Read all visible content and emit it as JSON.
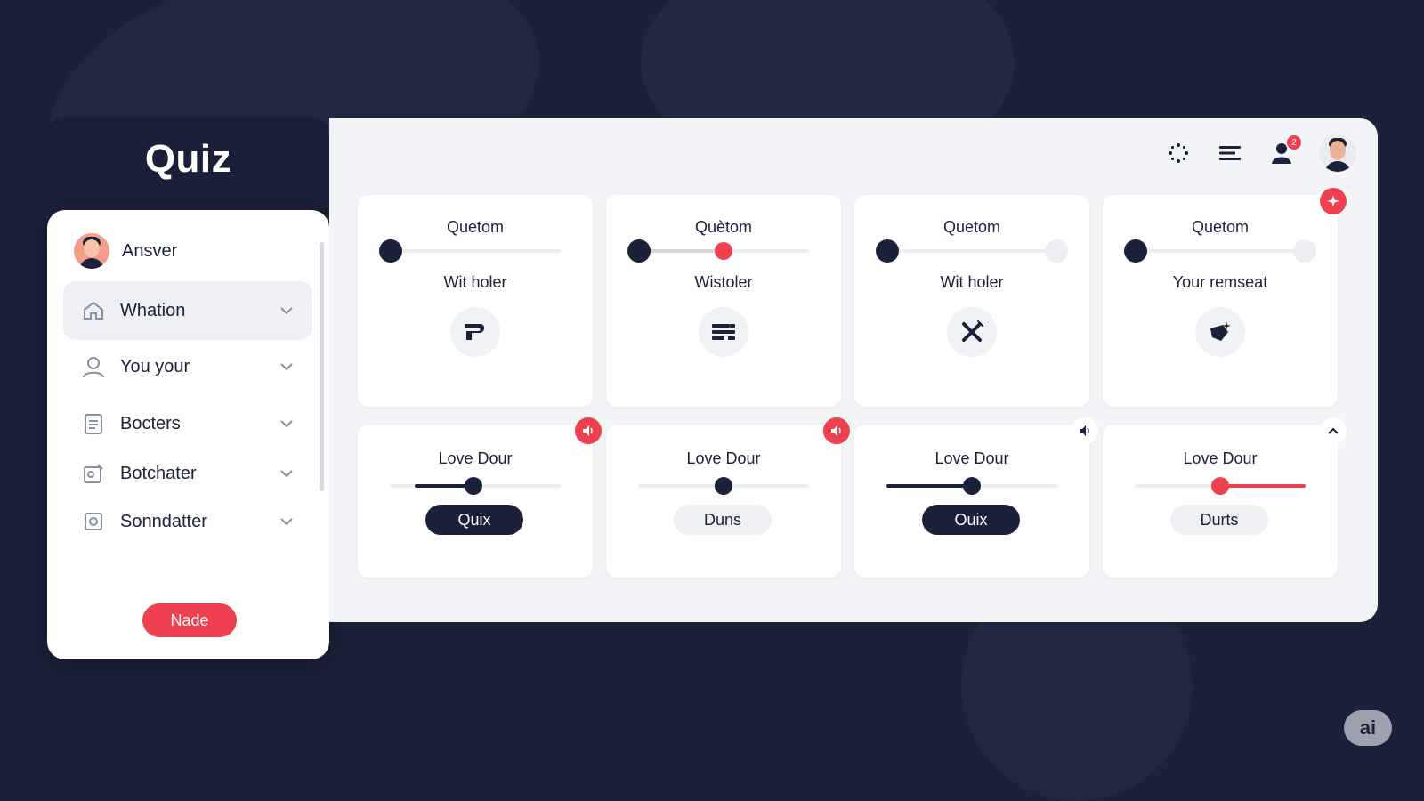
{
  "app": {
    "title": "Quiz"
  },
  "sidebar": {
    "user": {
      "name": "Ansver",
      "avatar": "avatar"
    },
    "items": [
      {
        "label": "Whation",
        "icon": "home-icon",
        "active": true
      },
      {
        "label": "You your",
        "icon": "user-icon",
        "active": false
      },
      {
        "label": "Bocters",
        "icon": "document-icon",
        "active": false
      },
      {
        "label": "Botchater",
        "icon": "edit-image-icon",
        "active": false
      },
      {
        "label": "Sonndatter",
        "icon": "frame-icon",
        "active": false
      }
    ],
    "action_label": "Nade"
  },
  "topbar": {
    "icons": [
      "loading-spinner-icon",
      "menu-lines-icon",
      "profile-icon",
      "user-avatar"
    ],
    "notification_count": "2"
  },
  "question_cards": [
    {
      "title": "Quetom",
      "subtitle": "Wit holer",
      "slider_value": 0.0,
      "icon": "flag-icon"
    },
    {
      "title": "Quètom",
      "subtitle": "Wistoler",
      "slider_value": 0.5,
      "icon": "list-icon"
    },
    {
      "title": "Quetom",
      "subtitle": "Wit holer",
      "slider_value": 0.0,
      "icon": "close-tools-icon"
    },
    {
      "title": "Quetom",
      "subtitle": "Your remseat",
      "slider_value": 0.0,
      "icon": "magic-shape-icon",
      "badge": "sparkle-icon"
    }
  ],
  "audio_cards": [
    {
      "title": "Love Dour",
      "slider_value": 0.35,
      "button": "Quix",
      "button_style": "dark",
      "badge": "speaker-icon"
    },
    {
      "title": "Love Dour",
      "slider_value": 0.5,
      "button": "Duns",
      "button_style": "light",
      "badge": "speaker-icon"
    },
    {
      "title": "Love Dour",
      "slider_value": 0.5,
      "button": "Ouix",
      "button_style": "dark",
      "badge": "volume-icon"
    },
    {
      "title": "Love Dour",
      "slider_value": 0.5,
      "button": "Durts",
      "button_style": "light",
      "badge": "chevron-up-icon"
    }
  ],
  "watermark": "ai",
  "colors": {
    "navy": "#1b2139",
    "accent": "#ef4050",
    "panel": "#f3f4f7"
  }
}
